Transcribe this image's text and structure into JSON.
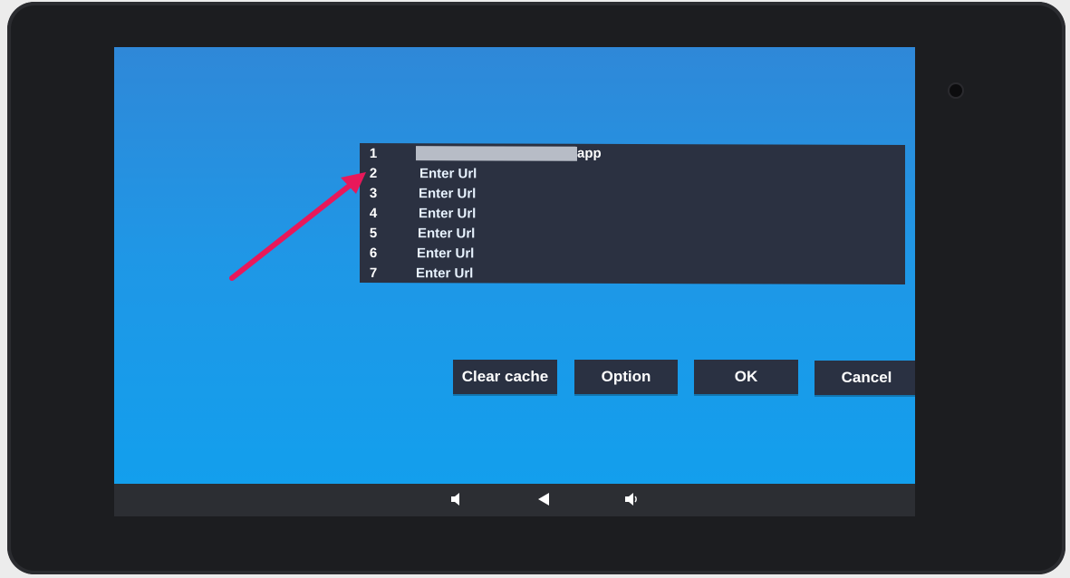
{
  "url_list": {
    "rows": [
      {
        "number": "1",
        "text": "",
        "suffix": "app"
      },
      {
        "number": "2",
        "text": "Enter Url"
      },
      {
        "number": "3",
        "text": "Enter Url"
      },
      {
        "number": "4",
        "text": "Enter Url"
      },
      {
        "number": "5",
        "text": "Enter Url"
      },
      {
        "number": "6",
        "text": "Enter Url"
      },
      {
        "number": "7",
        "text": "Enter Url"
      }
    ]
  },
  "buttons": {
    "clear_cache": "Clear cache",
    "option": "Option",
    "ok": "OK",
    "cancel": "Cancel"
  },
  "navbar": {
    "icons": [
      "volume-down-icon",
      "back-icon",
      "volume-up-icon"
    ]
  },
  "colors": {
    "screen_blue": "#1f97e6",
    "panel": "#2b3141",
    "button": "#2a3142",
    "annotation_arrow": "#e8185a"
  }
}
